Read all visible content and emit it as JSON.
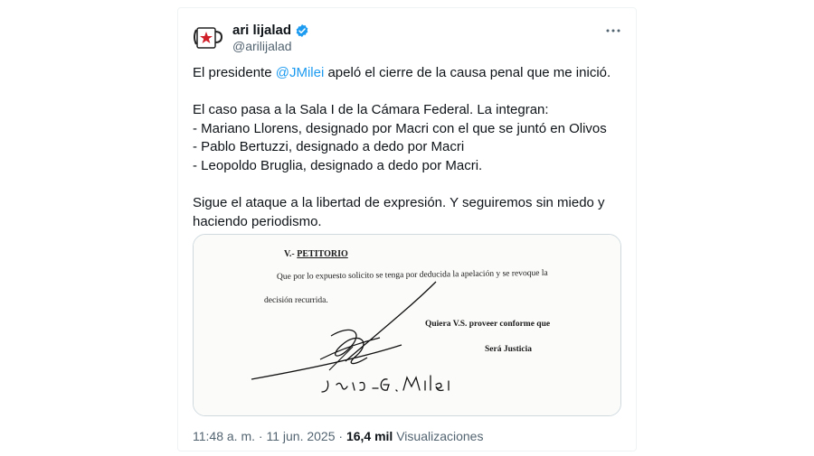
{
  "author": {
    "display_name": "ari lijalad",
    "handle": "@arilijalad",
    "avatar_icon": "mug-avatar-icon",
    "verified_icon": "verified-badge-icon",
    "verified_color": "#1d9bf0"
  },
  "more_icon": "more-dots-icon",
  "body": {
    "line1_prefix": "El presidente ",
    "mention": "@JMilei",
    "line1_suffix": " apeló el cierre de la causa penal que me inició.",
    "para2": "El caso pasa a la Sala I de la Cámara Federal. La integran:\n- Mariano Llorens, designado por Macri con el que se juntó en Olivos\n- Pablo Bertuzzi, designado a dedo por Macri\n- Leopoldo Bruglia, designado a dedo por Macri.",
    "para3": "Sigue el ataque a la libertad de expresión. Y seguiremos sin miedo y haciendo periodismo."
  },
  "document": {
    "heading_prefix": "V.- ",
    "heading": "PETITORIO",
    "line1": "Que por lo expuesto solicito se tenga por deducida la apelación y se revoque la",
    "line2": "decisión recurrida.",
    "quiera": "Quiera V.S. proveer conforme que",
    "justicia": "Será Justicia",
    "signature_text": "Javier G. Milei"
  },
  "meta": {
    "time": "11:48 a. m.",
    "sep1": " · ",
    "date": "11 jun. 2025",
    "sep2": " · ",
    "views_count": "16,4 mil",
    "views_label": " Visualizaciones"
  }
}
